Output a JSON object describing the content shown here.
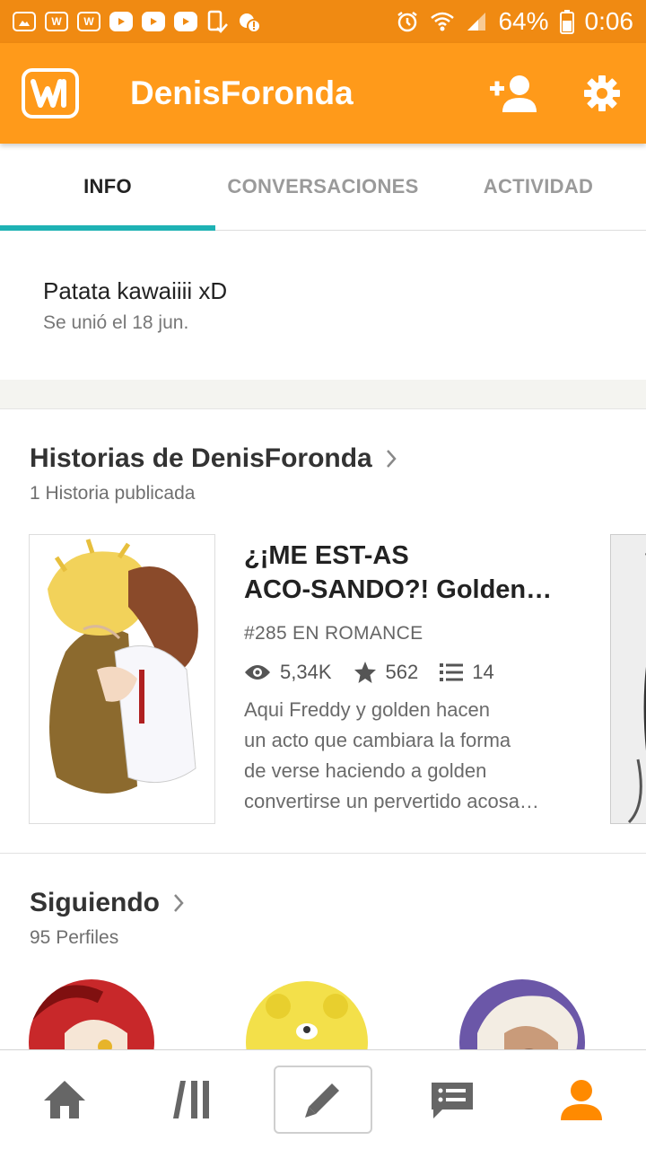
{
  "status_bar": {
    "battery": "64%",
    "time": "0:06"
  },
  "app_bar": {
    "title": "DenisForonda",
    "logo_letter": "W"
  },
  "tabs": [
    {
      "label": "INFO",
      "active": true
    },
    {
      "label": "CONVERSACIONES",
      "active": false
    },
    {
      "label": "ACTIVIDAD",
      "active": false
    }
  ],
  "info": {
    "tagline": "Patata kawaiiii xD",
    "joined": "Se unió el 18 jun."
  },
  "stories": {
    "title": "Historias de DenisForonda",
    "subtitle": "1 Historia publicada",
    "items": [
      {
        "title_line1": "¿¡ME EST-AS",
        "title_line2": "ACO-SANDO?!   Golden…",
        "rank": "#285 EN ROMANCE",
        "reads": "5,34K",
        "votes": "562",
        "parts": "14",
        "description_lines": [
          "Aqui Freddy y golden hacen",
          "un acto que cambiara la forma",
          "de verse haciendo a golden",
          "convertirse un pervertido acosa…"
        ]
      }
    ]
  },
  "following": {
    "title": "Siguiendo",
    "subtitle": "95 Perfiles"
  },
  "colors": {
    "status_bar": "#f08a12",
    "app_bar": "#ff9a1a",
    "tab_indicator": "#1eb2b4",
    "profile_active": "#ff8a00"
  },
  "bottom_nav": [
    "home-icon",
    "library-icon",
    "write-icon",
    "messages-icon",
    "profile-icon"
  ]
}
